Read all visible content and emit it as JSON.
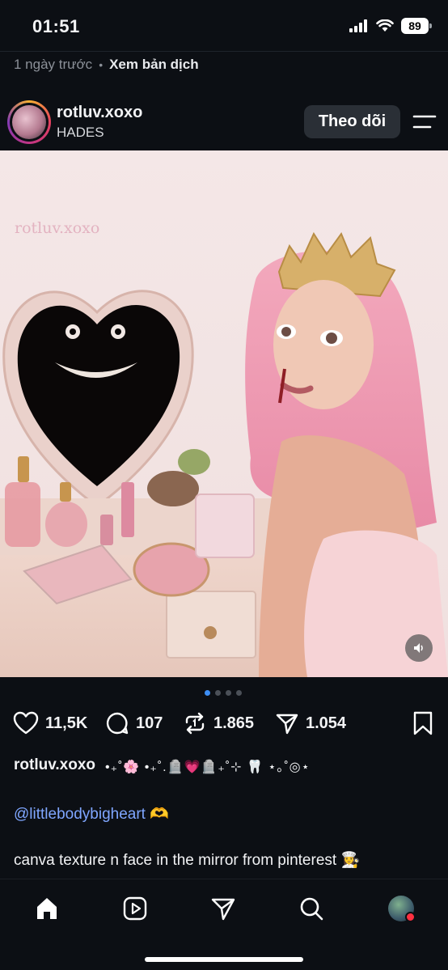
{
  "status": {
    "time": "01:51",
    "battery": "89"
  },
  "meta": {
    "posted": "1 ngày trước",
    "separator": "•",
    "translate": "Xem bản dịch"
  },
  "author": {
    "username": "rotluv.xoxo",
    "subtitle": "HADES",
    "follow_label": "Theo dõi"
  },
  "media": {
    "watermark": "rotluv.xoxo",
    "carousel": {
      "count": 4,
      "active": 0
    }
  },
  "actions": {
    "likes": "11,5K",
    "comments": "107",
    "reposts": "1.865",
    "shares": "1.054"
  },
  "caption": {
    "username": "rotluv.xoxo",
    "decoration": "•₊˚🌸 •₊˚.🪦💗🪦₊˚⊹ 🦷 ⋆｡˚◎⋆",
    "mention": "@littlebodybigheart",
    "mention_emoji": "🫶",
    "text": "canva texture n face in the mirror from pinterest 👩‍🍳"
  },
  "colors": {
    "background": "#0c0f14",
    "link": "#7fa6ff",
    "carousel_active": "#3d8ef5",
    "notification": "#ff3040"
  },
  "icons": [
    "signal-icon",
    "wifi-icon",
    "battery-icon",
    "menu-icon",
    "heart-icon",
    "comment-icon",
    "repost-icon",
    "share-icon",
    "bookmark-icon",
    "sound-icon",
    "home-icon",
    "reels-icon",
    "send-icon",
    "search-icon",
    "profile-icon"
  ]
}
